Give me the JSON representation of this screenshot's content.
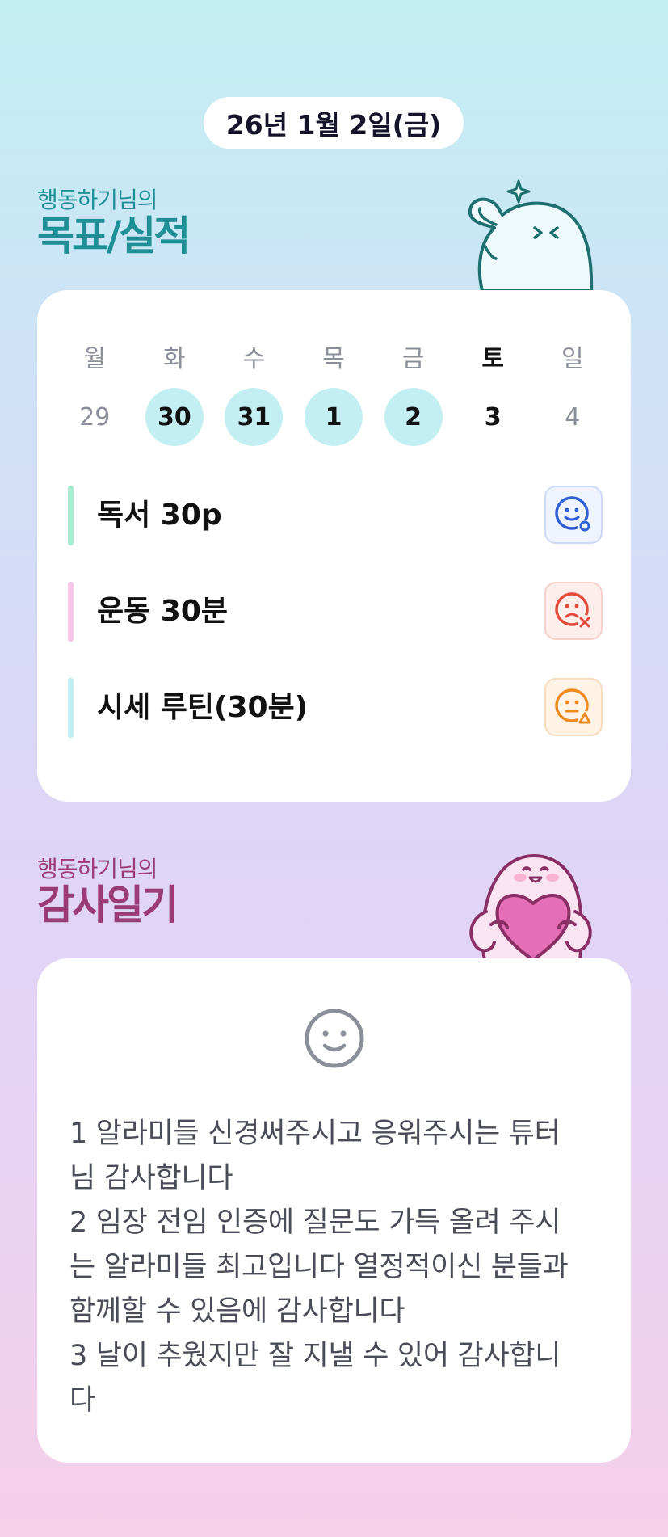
{
  "date": "26년 1월 2일(금)",
  "goals_section": {
    "owner": "행동하기님의",
    "title": "목표/실적",
    "mascot_icon": "ghost-mascot-thumbs-up-icon"
  },
  "calendar": {
    "weekdays": [
      "월",
      "화",
      "수",
      "목",
      "금",
      "토",
      "일"
    ],
    "dates": [
      "29",
      "30",
      "31",
      "1",
      "2",
      "3",
      "4"
    ],
    "completed": [
      false,
      true,
      true,
      true,
      true,
      false,
      false
    ],
    "highlight_color": "#c3eef2"
  },
  "goals": [
    {
      "name": "독서 30p",
      "bar_color": "#a5ecd0",
      "status_icon": "smile-circle-icon",
      "status_color": "#2f5fd6"
    },
    {
      "name": "운동 30분",
      "bar_color": "#f7c5e6",
      "status_icon": "frown-x-icon",
      "status_color": "#e24b3b"
    },
    {
      "name": "시세 루틴(30분)",
      "bar_color": "#bfeef3",
      "status_icon": "neutral-triangle-icon",
      "status_color": "#ee8a1f"
    }
  ],
  "diary_section": {
    "owner": "행동하기님의",
    "title": "감사일기",
    "mascot_icon": "ghost-mascot-heart-icon",
    "mood_icon": "smiley-face-icon",
    "lines": [
      "1 알라미들 신경써주시고 응워주시는 튜터",
      "님 감사합니다",
      "2 임장 전임 인증에 질문도 가득 올려 주시",
      "는 알라미들 최고입니다 열정적이신 분들과",
      "함께할 수 있음에 감사합니다",
      "3 날이 추웠지만 잘 지낼 수 있어 감사합니",
      "다"
    ]
  }
}
